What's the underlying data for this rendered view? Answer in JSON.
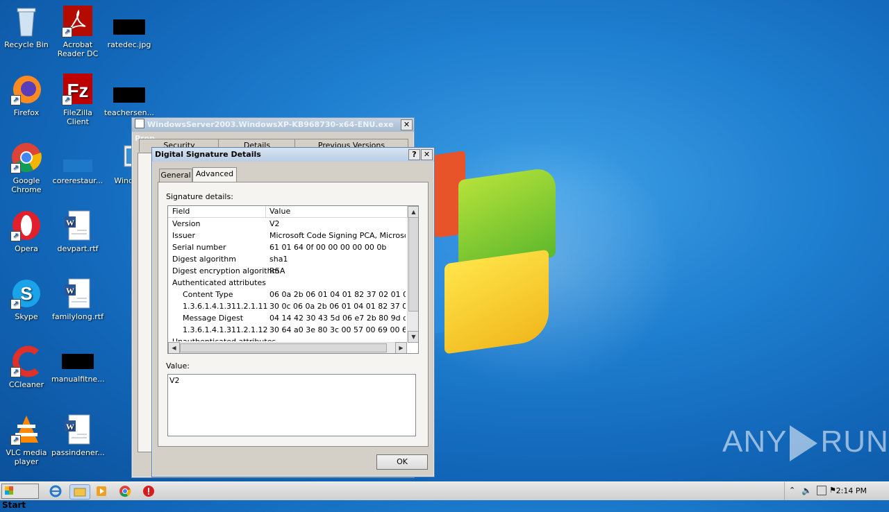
{
  "desktop": {
    "icons": [
      {
        "label": "Recycle Bin",
        "icon": "recycle-bin-icon"
      },
      {
        "label": "Acrobat Reader DC",
        "icon": "acrobat-icon"
      },
      {
        "label": "ratedec.jpg",
        "icon": "image-file-icon"
      },
      {
        "label": "Firefox",
        "icon": "firefox-icon"
      },
      {
        "label": "FileZilla Client",
        "icon": "filezilla-icon"
      },
      {
        "label": "teachersen...",
        "icon": "file-icon"
      },
      {
        "label": "Google Chrome",
        "icon": "chrome-icon"
      },
      {
        "label": "corerestaur...",
        "icon": "file-icon"
      },
      {
        "label": "Window",
        "icon": "exe-icon"
      },
      {
        "label": "Opera",
        "icon": "opera-icon"
      },
      {
        "label": "devpart.rtf",
        "icon": "word-doc-icon"
      },
      {
        "label": "Skype",
        "icon": "skype-icon"
      },
      {
        "label": "familylong.rtf",
        "icon": "word-doc-icon"
      },
      {
        "label": "CCleaner",
        "icon": "ccleaner-icon"
      },
      {
        "label": "manualfitne...",
        "icon": "file-icon"
      },
      {
        "label": "VLC media player",
        "icon": "vlc-icon"
      },
      {
        "label": "passindener...",
        "icon": "word-doc-icon"
      }
    ],
    "watermark": {
      "left": "ANY",
      "right": "RUN"
    }
  },
  "props_window": {
    "title": "WindowsServer2003.WindowsXP-KB968730-x64-ENU.exe Prop...",
    "close": "✕",
    "tabs": [
      "Security",
      "Details",
      "Previous Versions"
    ]
  },
  "dialog": {
    "title": "Digital Signature Details",
    "help": "?",
    "close": "✕",
    "tabs": [
      "General",
      "Advanced"
    ],
    "selected_tab": "Advanced",
    "signature_details_label": "Signature details:",
    "columns": {
      "field": "Field",
      "value": "Value"
    },
    "rows": [
      {
        "field": "Version",
        "value": "V2",
        "indent": 0
      },
      {
        "field": "Issuer",
        "value": "Microsoft Code Signing PCA, Microsoft C...",
        "indent": 0
      },
      {
        "field": "Serial number",
        "value": "61 01 64 0f 00 00 00 00 00 0b",
        "indent": 0
      },
      {
        "field": "Digest algorithm",
        "value": "sha1",
        "indent": 0
      },
      {
        "field": "Digest encryption algorithm",
        "value": "RSA",
        "indent": 0
      },
      {
        "field": "Authenticated attributes",
        "value": "",
        "indent": 0
      },
      {
        "field": "Content Type",
        "value": "06 0a 2b 06 01 04 01 82 37 02 01 04",
        "indent": 1
      },
      {
        "field": "1.3.6.1.4.1.311.2.1.11",
        "value": "30 0c 06 0a 2b 06 01 04 01 82 37 02 01 1...",
        "indent": 1
      },
      {
        "field": "Message Digest",
        "value": "04 14 42 30 43 5d 06 e7 2b 80 9d d6 c1 ...",
        "indent": 1
      },
      {
        "field": "1.3.6.1.4.1.311.2.1.12",
        "value": "30 64 a0 3e 80 3c 00 57 00 69 00 6e 00 ...",
        "indent": 1
      },
      {
        "field": "Unauthenticated attributes",
        "value": "",
        "indent": 0
      }
    ],
    "value_label": "Value:",
    "value_text": "V2",
    "ok": "OK"
  },
  "taskbar": {
    "start": "Start",
    "apps": [
      "ie-icon",
      "explorer-icon",
      "media-player-icon",
      "chrome-icon",
      "antivirus-icon"
    ],
    "tray_icons": [
      "chevron-up-icon",
      "speaker-icon",
      "network-icon",
      "flag-icon"
    ],
    "clock": "2:14 PM"
  }
}
